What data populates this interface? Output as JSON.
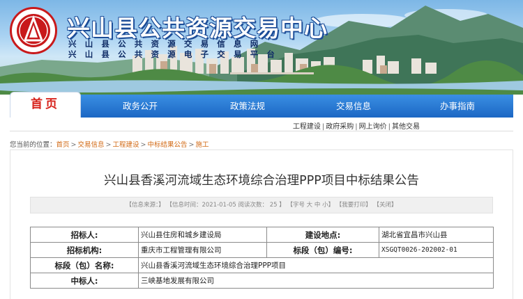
{
  "header": {
    "title": "兴山县公共资源交易中心",
    "subtitle_1": "兴山县公共资源交易信息网",
    "subtitle_2": "兴山县公共资源电子交易平台",
    "logo_icon": "emblem-logo-icon"
  },
  "nav": {
    "home": "首页",
    "items": [
      "政务公开",
      "政策法规",
      "交易信息",
      "办事指南"
    ]
  },
  "subnav": {
    "links": [
      "工程建设",
      "政府采购",
      "网上询价",
      "其他交易"
    ]
  },
  "breadcrumb": {
    "prefix": "您当前的位置：",
    "items": [
      "首页",
      "交易信息",
      "工程建设",
      "中标结果公告",
      "施工"
    ]
  },
  "article": {
    "title": "兴山县香溪河流域生态环境综合治理PPP项目中标结果公告",
    "info": {
      "source": "【信息来源：】",
      "date": "【信息时间：2021-01-05  阅读次数： 25 】",
      "font": "【字号 大 中 小】",
      "print": "【我要打印】",
      "close": "【关闭】"
    }
  },
  "table": {
    "rows": [
      [
        "招标人:",
        "兴山县住房和城乡建设局",
        "建设地点:",
        "湖北省宜昌市兴山县"
      ],
      [
        "招标机构:",
        "重庆市工程管理有限公司",
        "标段（包）编号:",
        "XSGQT0026-202002-01"
      ],
      [
        "标段（包）名称:",
        "兴山县香溪河流域生态环境综合治理PPP项目"
      ],
      [
        "中标人:",
        "三峡基地发展有限公司"
      ]
    ]
  },
  "colors": {
    "nav_blue": "#1c67c4",
    "home_red": "#d7231c",
    "breadcrumb_orange": "#d26a15",
    "title_outline": "#1c4d98"
  }
}
